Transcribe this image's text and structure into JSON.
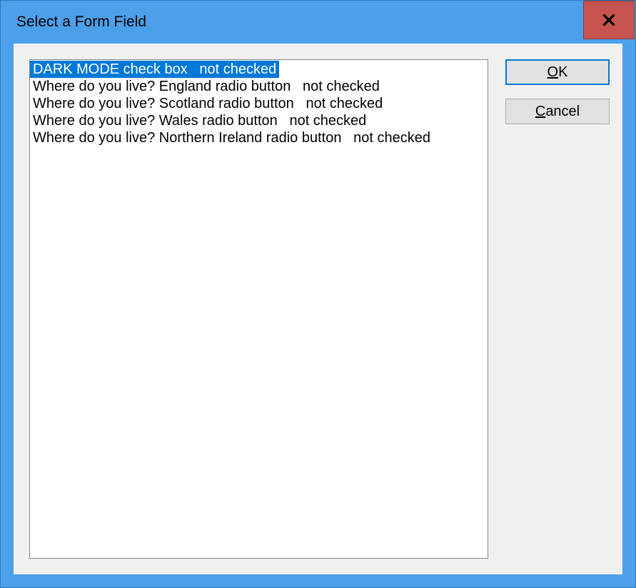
{
  "title": "Select a Form Field",
  "list": {
    "items": [
      {
        "label": "DARK MODE check box   not checked",
        "selected": true
      },
      {
        "label": "Where do you live? England radio button   not checked",
        "selected": false
      },
      {
        "label": "Where do you live? Scotland radio button   not checked",
        "selected": false
      },
      {
        "label": "Where do you live? Wales radio button   not checked",
        "selected": false
      },
      {
        "label": "Where do you live? Northern Ireland radio button   not checked",
        "selected": false
      }
    ]
  },
  "buttons": {
    "ok_prefix": "O",
    "ok_rest": "K",
    "cancel_prefix": "C",
    "cancel_rest": "ancel"
  }
}
